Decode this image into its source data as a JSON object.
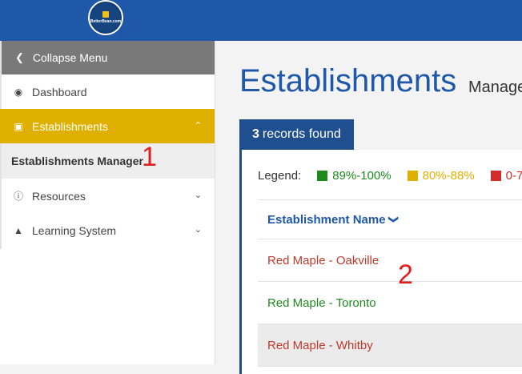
{
  "header": {
    "logo_text": "BetterBean.com"
  },
  "sidebar": {
    "collapse_label": "Collapse Menu",
    "items": [
      {
        "label": "Dashboard",
        "icon": "dashboard-icon"
      },
      {
        "label": "Establishments",
        "icon": "briefcase-icon"
      },
      {
        "label": "Establishments Manager"
      },
      {
        "label": "Resources",
        "icon": "info-icon"
      },
      {
        "label": "Learning System",
        "icon": "graduation-cap-icon"
      }
    ]
  },
  "annotations": {
    "one": "1",
    "two": "2"
  },
  "main": {
    "title": "Establishments",
    "subtitle": "Manage",
    "records_count": "3",
    "records_label": "records found",
    "legend": {
      "label": "Legend:",
      "items": [
        {
          "text": "89%-100%",
          "color": "#1e8a1e"
        },
        {
          "text": "80%-88%",
          "color": "#e0b000"
        },
        {
          "text": "0-7",
          "color": "#d42a2a"
        }
      ]
    },
    "table": {
      "column_header": "Establishment Name",
      "rows": [
        {
          "name": "Red Maple - Oakville",
          "color": "#c0392b"
        },
        {
          "name": "Red Maple - Toronto",
          "color": "#1e8a1e"
        },
        {
          "name": "Red Maple - Whitby",
          "color": "#c0392b"
        }
      ]
    }
  }
}
